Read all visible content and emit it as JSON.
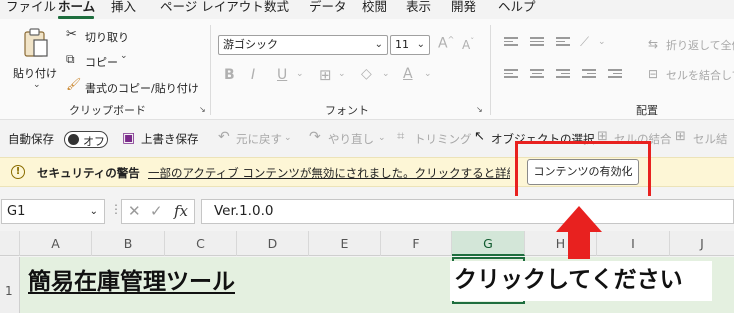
{
  "menu": {
    "tabs": [
      "ファイル",
      "ホーム",
      "挿入",
      "ページ レイアウト",
      "数式",
      "データ",
      "校閲",
      "表示",
      "開発",
      "ヘルプ"
    ]
  },
  "ribbon": {
    "clipboard": {
      "paste": "貼り付け",
      "cut": "切り取り",
      "copy": "コピー",
      "format_painter": "書式のコピー/貼り付け",
      "group_label": "クリップボード"
    },
    "font": {
      "font_name": "游ゴシック",
      "font_size": "11",
      "grow_label": "A",
      "shrink_label": "A",
      "bold": "B",
      "italic": "I",
      "underline": "U",
      "color_a": "A",
      "group_label": "フォント"
    },
    "alignment": {
      "wrap_text": "折り返して全体",
      "merge": "セルを結合して",
      "group_label": "配置"
    }
  },
  "qat": {
    "autosave_label": "自動保存",
    "autosave_state": "オフ",
    "overwrite_save": "上書き保存",
    "undo": "元に戻す",
    "redo": "やり直し",
    "trimming": "トリミング",
    "select_object": "オブジェクトの選択",
    "merge_cells": "セルの結合",
    "cell_style": "セル結"
  },
  "security_bar": {
    "title": "セキュリティの警告",
    "message": "一部のアクティブ コンテンツが無効にされました。クリックすると詳細が表示されます。",
    "enable_button": "コンテンツの有効化"
  },
  "formula_bar": {
    "name_box": "G1",
    "formula": "Ver.1.0.0"
  },
  "grid": {
    "columns": [
      "A",
      "B",
      "C",
      "D",
      "E",
      "F",
      "G",
      "H",
      "I",
      "J"
    ],
    "selected_column": "G",
    "row_number": "1",
    "cell_a1": "簡易在庫管理ツール",
    "cell_g1": "クリックしてください"
  },
  "colors": {
    "accent": "#1e6e3e",
    "highlight_red": "#e8211f",
    "security_bg": "#fdf6d6"
  }
}
